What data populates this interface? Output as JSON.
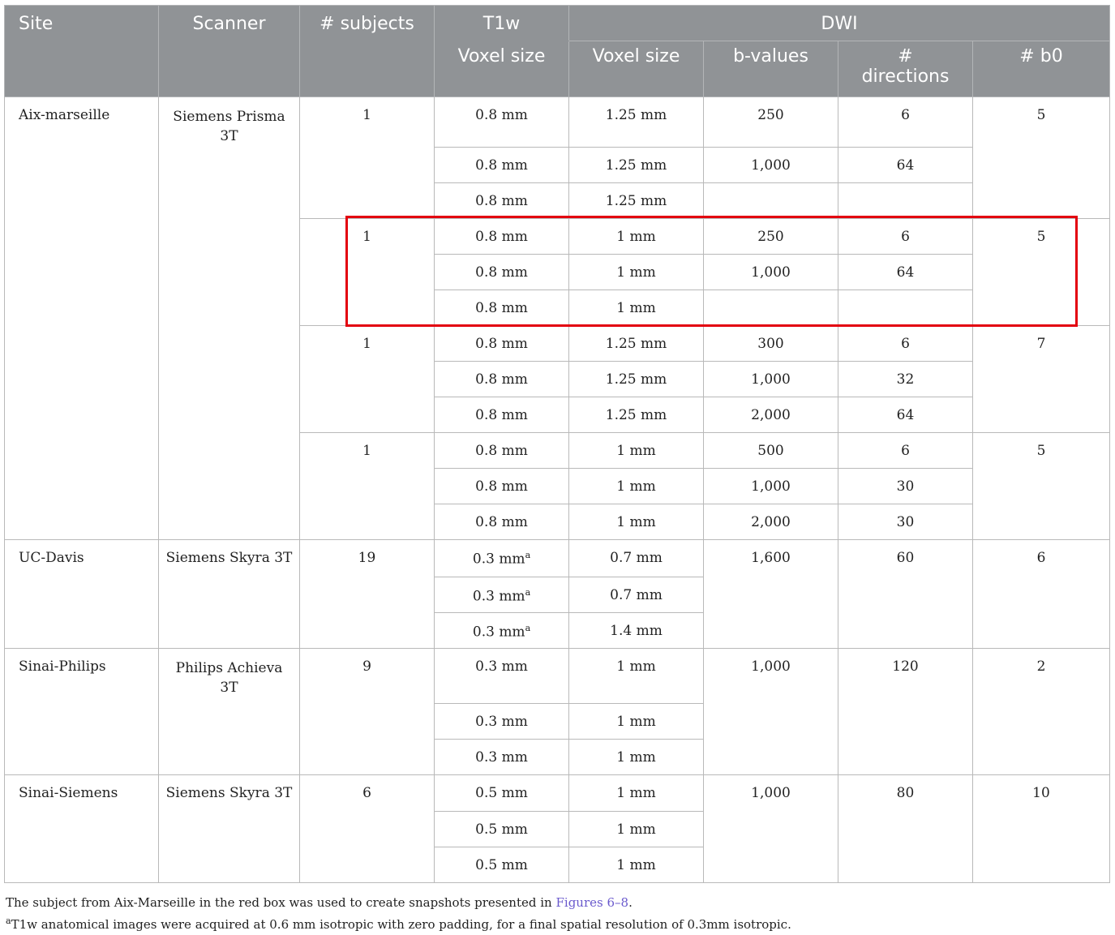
{
  "headers": {
    "site": "Site",
    "scanner": "Scanner",
    "subjects": "# subjects",
    "t1w": "T1w",
    "dwi": "DWI",
    "t1w_voxel": "Voxel size",
    "dwi_voxel": "Voxel size",
    "bvalues": "b-values",
    "dir_hash": "#",
    "dir_word": "directions",
    "b0": "# b0"
  },
  "rows": {
    "aix": {
      "site": "Aix-marseille",
      "scanner_1": "Siemens Prisma",
      "scanner_2": "3T",
      "g1": {
        "subjects": "1",
        "b0": "5",
        "r": [
          {
            "t1": "0.8 mm",
            "vox": "1.25 mm",
            "b": "250",
            "dir": "6"
          },
          {
            "t1": "0.8 mm",
            "vox": "1.25 mm",
            "b": "1,000",
            "dir": "64"
          },
          {
            "t1": "0.8 mm",
            "vox": "1.25 mm"
          }
        ]
      },
      "g2": {
        "subjects": "1",
        "b0": "5",
        "r": [
          {
            "t1": "0.8 mm",
            "vox": "1 mm",
            "b": "250",
            "dir": "6"
          },
          {
            "t1": "0.8 mm",
            "vox": "1 mm",
            "b": "1,000",
            "dir": "64"
          },
          {
            "t1": "0.8 mm",
            "vox": "1 mm"
          }
        ]
      },
      "g3": {
        "subjects": "1",
        "b0": "7",
        "r": [
          {
            "t1": "0.8 mm",
            "vox": "1.25 mm",
            "b": "300",
            "dir": "6"
          },
          {
            "t1": "0.8 mm",
            "vox": "1.25 mm",
            "b": "1,000",
            "dir": "32"
          },
          {
            "t1": "0.8 mm",
            "vox": "1.25 mm",
            "b": "2,000",
            "dir": "64"
          }
        ]
      },
      "g4": {
        "subjects": "1",
        "b0": "5",
        "r": [
          {
            "t1": "0.8 mm",
            "vox": "1 mm",
            "b": "500",
            "dir": "6"
          },
          {
            "t1": "0.8 mm",
            "vox": "1 mm",
            "b": "1,000",
            "dir": "30"
          },
          {
            "t1": "0.8 mm",
            "vox": "1 mm",
            "b": "2,000",
            "dir": "30"
          }
        ]
      }
    },
    "ucd": {
      "site": "UC-Davis",
      "scanner": "Siemens Skyra 3T",
      "subjects": "19",
      "b": "1,600",
      "dir": "60",
      "b0": "6",
      "sup": "a",
      "r": [
        {
          "t1": "0.3 mm",
          "vox": "0.7 mm"
        },
        {
          "t1": "0.3 mm",
          "vox": "0.7 mm"
        },
        {
          "t1": "0.3 mm",
          "vox": "1.4 mm"
        }
      ]
    },
    "sp": {
      "site": "Sinai-Philips",
      "scanner_1": "Philips Achieva",
      "scanner_2": "3T",
      "subjects": "9",
      "b": "1,000",
      "dir": "120",
      "b0": "2",
      "r": [
        {
          "t1": "0.3 mm",
          "vox": "1 mm"
        },
        {
          "t1": "0.3 mm",
          "vox": "1 mm"
        },
        {
          "t1": "0.3 mm",
          "vox": "1 mm"
        }
      ]
    },
    "ss": {
      "site": "Sinai-Siemens",
      "scanner": "Siemens Skyra 3T",
      "subjects": "6",
      "b": "1,000",
      "dir": "80",
      "b0": "10",
      "r": [
        {
          "t1": "0.5 mm",
          "vox": "1 mm"
        },
        {
          "t1": "0.5 mm",
          "vox": "1 mm"
        },
        {
          "t1": "0.5 mm",
          "vox": "1 mm"
        }
      ]
    }
  },
  "footnotes": {
    "line1_pre": "The subject from Aix-Marseille in the red box was used to create snapshots presented in ",
    "line1_link": "Figures 6–8",
    "line1_post": ".",
    "line2_sup": "a",
    "line2": "T1w anatomical images were acquired at 0.6 mm isotropic with zero padding, for a final spatial resolution of 0.3mm isotropic."
  }
}
